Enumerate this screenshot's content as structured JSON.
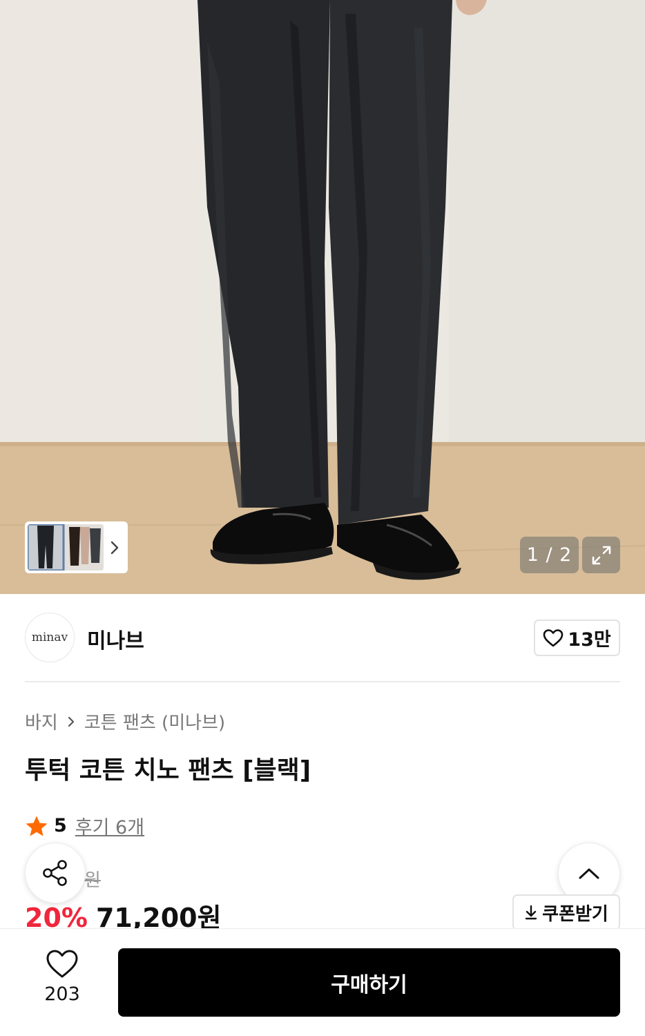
{
  "gallery": {
    "counter": "1 / 2",
    "current_index": 1,
    "total": 2
  },
  "brand": {
    "logo_text": "minav",
    "name": "미나브",
    "like_count": "13만"
  },
  "breadcrumb": {
    "category": "바지",
    "subcategory": "코튼 팬츠 (미나브)"
  },
  "product": {
    "title": "투턱 코튼 치노 팬츠 [블랙]",
    "rating": "5",
    "review_link": "후기 6개",
    "original_price_fragment": "원",
    "discount": "20%",
    "price": "71,200원"
  },
  "actions": {
    "coupon_label": "쿠폰받기",
    "buy_label": "구매하기",
    "wishlist_count": "203"
  },
  "colors": {
    "discount_red": "#f0263c",
    "star_orange": "#ff6a00",
    "buy_button": "#000000"
  },
  "icons": {
    "gallery_next": "chevron-right-icon",
    "expand": "expand-icon",
    "brand_like": "heart-icon",
    "breadcrumb_sep": "chevron-right-icon",
    "rating": "star-icon",
    "share": "share-icon",
    "scroll_top": "chevron-up-icon",
    "coupon": "download-icon",
    "wishlist": "heart-icon"
  }
}
